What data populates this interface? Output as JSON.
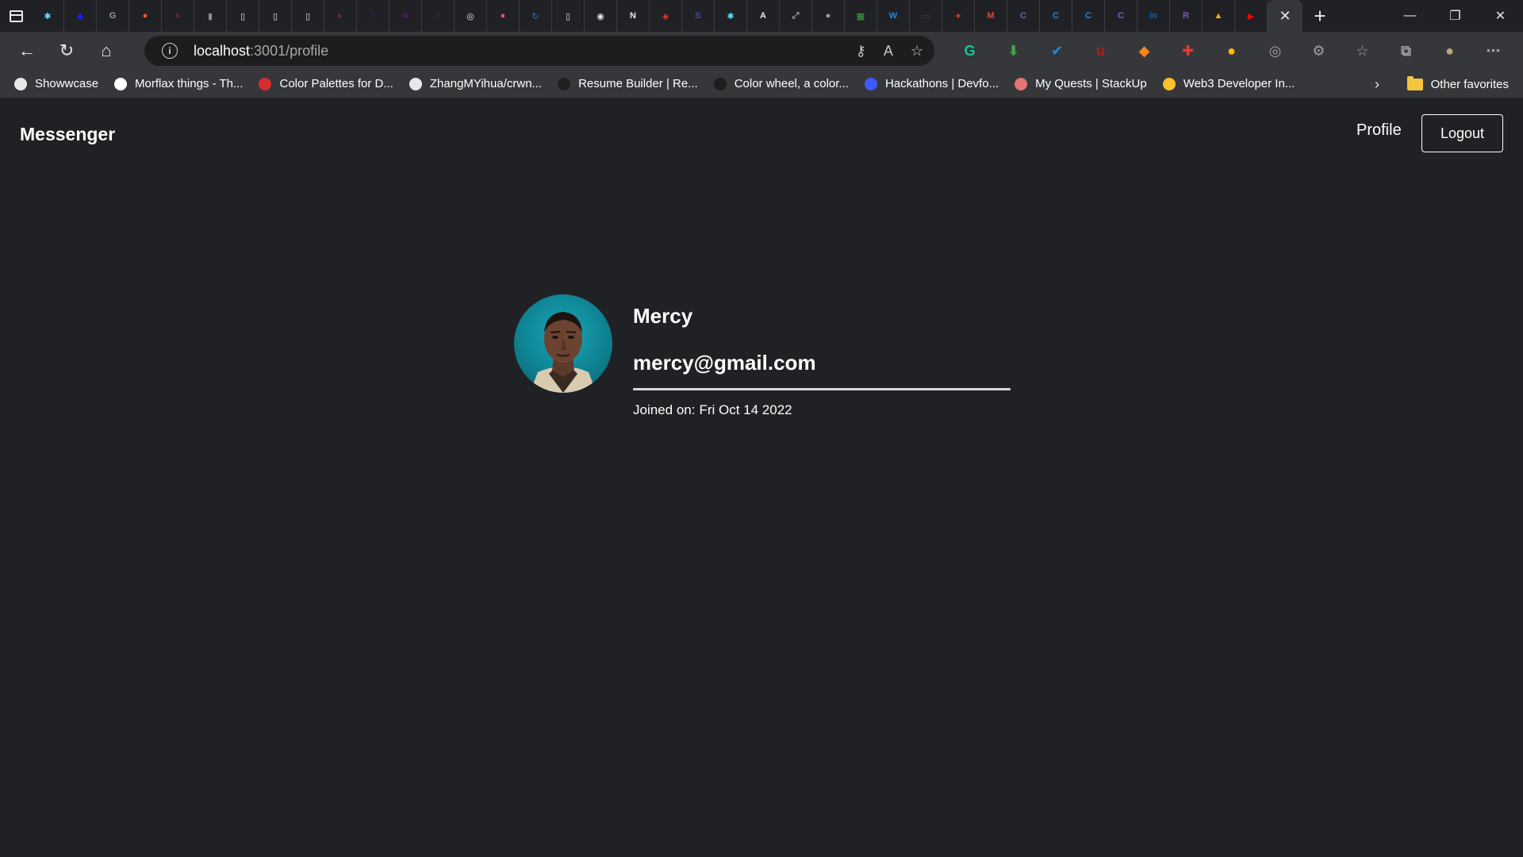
{
  "browser": {
    "tabs": [
      {
        "icon": "react-icon",
        "color": "#61dafb",
        "glyph": "✱"
      },
      {
        "icon": "shield-icon",
        "color": "#1a1aff",
        "glyph": "◆"
      },
      {
        "icon": "google-icon",
        "color": "#9aa0a6",
        "glyph": "G"
      },
      {
        "icon": "reddit-icon",
        "color": "#ff5722",
        "glyph": "●"
      },
      {
        "icon": "code-icon",
        "color": "#d32f2f",
        "glyph": "‹"
      },
      {
        "icon": "doc-icon",
        "color": "#8d8d8d",
        "glyph": "▮"
      },
      {
        "icon": "page-icon",
        "color": "#e8e8e8",
        "glyph": "▯"
      },
      {
        "icon": "page-icon",
        "color": "#e8e8e8",
        "glyph": "▯"
      },
      {
        "icon": "page-icon",
        "color": "#e8e8e8",
        "glyph": "▯"
      },
      {
        "icon": "figma-icon",
        "color": "#c2185b",
        "glyph": "◐"
      },
      {
        "icon": "dot-icon",
        "color": "#1a237e",
        "glyph": "•"
      },
      {
        "icon": "chart-icon",
        "color": "#6a1b9a",
        "glyph": "≈"
      },
      {
        "icon": "pen-icon",
        "color": "#333333",
        "glyph": "♪"
      },
      {
        "icon": "target-icon",
        "color": "#e8e8e8",
        "glyph": "◎"
      },
      {
        "icon": "dribbble-icon",
        "color": "#ea4c89",
        "glyph": "●"
      },
      {
        "icon": "sync-icon",
        "color": "#1565c0",
        "glyph": "↻"
      },
      {
        "icon": "page-icon",
        "color": "#e8e8e8",
        "glyph": "▯"
      },
      {
        "icon": "github-icon",
        "color": "#e8e8e8",
        "glyph": "◉"
      },
      {
        "icon": "notion-icon",
        "color": "#e8e8e8",
        "glyph": "N"
      },
      {
        "icon": "app-icon",
        "color": "#e53935",
        "glyph": "◈"
      },
      {
        "icon": "swift-icon",
        "color": "#3949ab",
        "glyph": "S"
      },
      {
        "icon": "react-icon",
        "color": "#61dafb",
        "glyph": "✱"
      },
      {
        "icon": "font-icon",
        "color": "#e8e8e8",
        "glyph": "A"
      },
      {
        "icon": "expand-icon",
        "color": "#9aa0a6",
        "glyph": "⤢"
      },
      {
        "icon": "apple-icon",
        "color": "#9aa0a6",
        "glyph": "●"
      },
      {
        "icon": "grid-icon",
        "color": "#43a047",
        "glyph": "▦"
      },
      {
        "icon": "word-icon",
        "color": "#1e88e5",
        "glyph": "W"
      },
      {
        "icon": "calendar-icon",
        "color": "#424242",
        "glyph": "▭"
      },
      {
        "icon": "maple-icon",
        "color": "#e53935",
        "glyph": "✦"
      },
      {
        "icon": "gmail-icon",
        "color": "#ea4335",
        "glyph": "M"
      },
      {
        "icon": "c-icon",
        "color": "#5c6bc0",
        "glyph": "C"
      },
      {
        "icon": "c-icon",
        "color": "#1e88e5",
        "glyph": "C"
      },
      {
        "icon": "c-icon",
        "color": "#1e88e5",
        "glyph": "C"
      },
      {
        "icon": "c-icon",
        "color": "#5c6bc0",
        "glyph": "C"
      },
      {
        "icon": "linkedin-icon",
        "color": "#0a66c2",
        "glyph": "in"
      },
      {
        "icon": "r-icon",
        "color": "#7e57c2",
        "glyph": "R"
      },
      {
        "icon": "fire-icon",
        "color": "#f4b400",
        "glyph": "▲"
      },
      {
        "icon": "youtube-icon",
        "color": "#ff0000",
        "glyph": "▶"
      }
    ],
    "url_host": "localhost",
    "url_rest": ":3001/profile",
    "extensions": [
      {
        "icon": "grammarly-icon",
        "color": "#15c39a",
        "glyph": "G"
      },
      {
        "icon": "download-icon",
        "color": "#43a047",
        "glyph": "⬇"
      },
      {
        "icon": "check-icon",
        "color": "#1e88e5",
        "glyph": "✔"
      },
      {
        "icon": "ublock-icon",
        "color": "#b71c1c",
        "glyph": "u"
      },
      {
        "icon": "metamask-icon",
        "color": "#f6851b",
        "glyph": "◆"
      },
      {
        "icon": "puzzle-red-icon",
        "color": "#e53935",
        "glyph": "✚"
      },
      {
        "icon": "chrome-icon",
        "color": "#fbbc04",
        "glyph": "●"
      },
      {
        "icon": "target-icon",
        "color": "#9aa0a6",
        "glyph": "◎"
      },
      {
        "icon": "extensions-icon",
        "color": "#9aa0a6",
        "glyph": "⚙"
      },
      {
        "icon": "favorites-icon",
        "color": "#9aa0a6",
        "glyph": "☆"
      },
      {
        "icon": "collections-icon",
        "color": "#9aa0a6",
        "glyph": "⧉"
      },
      {
        "icon": "avatar-icon",
        "color": "#c0a080",
        "glyph": "●"
      },
      {
        "icon": "more-icon",
        "color": "#9aa0a6",
        "glyph": "⋯"
      }
    ],
    "bookmarks": [
      {
        "label": "Showwcase",
        "color": "#e8e8e8"
      },
      {
        "label": "Morflax things - Th...",
        "color": "#ffffff"
      },
      {
        "label": "Color Palettes for D...",
        "color": "#d32f2f"
      },
      {
        "label": "ZhangMYihua/crwn...",
        "color": "#e8e8e8"
      },
      {
        "label": "Resume Builder | Re...",
        "color": "#212121"
      },
      {
        "label": "Color wheel, a color...",
        "color": "#1e1e1e"
      },
      {
        "label": "Hackathons | Devfo...",
        "color": "#3d5afe"
      },
      {
        "label": "My Quests | StackUp",
        "color": "#e57373"
      },
      {
        "label": "Web3 Developer In...",
        "color": "#fbc02d"
      }
    ],
    "other_favorites": "Other favorites"
  },
  "navbar": {
    "brand": "Messenger",
    "profile_link": "Profile",
    "logout_button": "Logout"
  },
  "profile": {
    "name": "Mercy",
    "email": "mercy@gmail.com",
    "joined_label": "Joined on:",
    "joined_date": "Fri Oct 14 2022"
  }
}
